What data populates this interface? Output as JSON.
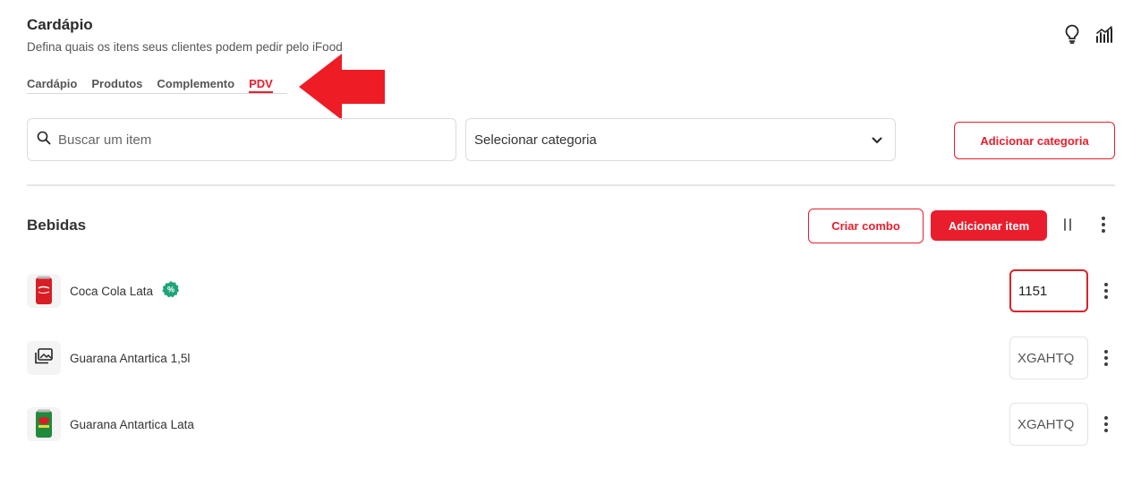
{
  "header": {
    "title": "Cardápio",
    "subtitle": "Defina quais os itens seus clientes podem pedir pelo iFood"
  },
  "tabs": [
    {
      "label": "Cardápio",
      "active": false
    },
    {
      "label": "Produtos",
      "active": false
    },
    {
      "label": "Complemento",
      "active": false
    },
    {
      "label": "PDV",
      "active": true
    }
  ],
  "top_icons": [
    "lightbulb-icon",
    "analytics-icon"
  ],
  "filters": {
    "search_placeholder": "Buscar um item",
    "category_select": "Selecionar categoria",
    "add_category_label": "Adicionar categoria"
  },
  "section": {
    "title": "Bebidas",
    "criar_combo_label": "Criar combo",
    "add_item_label": "Adicionar item",
    "items": [
      {
        "name": "Coca Cola Lata",
        "has_promo_badge": true,
        "pdv_code": "1151",
        "thumb": "red-can"
      },
      {
        "name": "Guarana Antartica 1,5l",
        "has_promo_badge": false,
        "pdv_code": "XGAHTQ",
        "thumb": "image-placeholder-icon"
      },
      {
        "name": "Guarana Antartica Lata",
        "has_promo_badge": false,
        "pdv_code": "XGAHTQ",
        "thumb": "green-can"
      }
    ]
  },
  "colors": {
    "accent": "#ea1d2c",
    "promo_badge": "#1fa37a",
    "arrow": "#ee1c25"
  }
}
